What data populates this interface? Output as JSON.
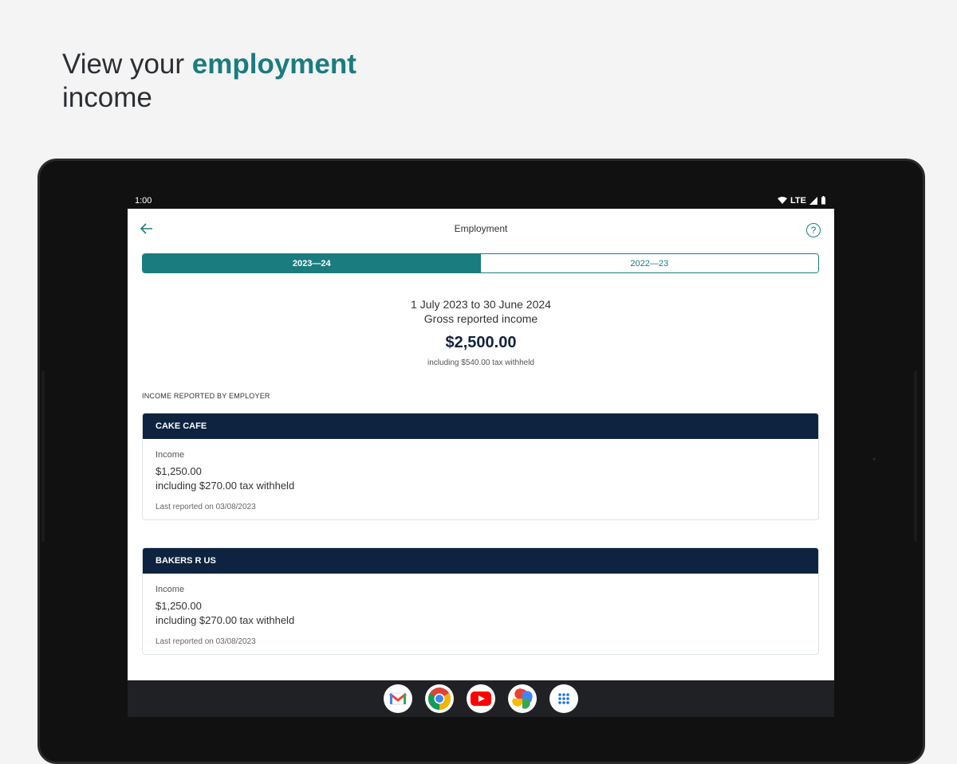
{
  "promo": {
    "heading_part1": "View your ",
    "heading_accent": "employment",
    "heading_part2": "income"
  },
  "status_bar": {
    "time": "1:00",
    "network": "LTE"
  },
  "app_bar": {
    "title": "Employment",
    "help_symbol": "?"
  },
  "year_tabs": [
    {
      "label": "2023—24",
      "selected": true
    },
    {
      "label": "2022—23",
      "selected": false
    }
  ],
  "summary": {
    "period": "1 July 2023 to 30 June 2024",
    "label": "Gross reported income",
    "amount": "$2,500.00",
    "withheld": "including $540.00 tax withheld"
  },
  "section_heading": "INCOME REPORTED BY EMPLOYER",
  "employers": [
    {
      "name": "CAKE CAFE",
      "income_label": "Income",
      "amount": "$1,250.00",
      "tax": "including $270.00 tax withheld",
      "reported": "Last reported on 03/08/2023"
    },
    {
      "name": "BAKERS R US",
      "income_label": "Income",
      "amount": "$1,250.00",
      "tax": "including $270.00 tax withheld",
      "reported": "Last reported on 03/08/2023"
    }
  ],
  "dock": {
    "apps": [
      "gmail-icon",
      "chrome-icon",
      "youtube-icon",
      "photos-icon",
      "app-drawer-icon"
    ]
  },
  "colors": {
    "accent": "#1b7c7f",
    "navy": "#0d2340"
  }
}
